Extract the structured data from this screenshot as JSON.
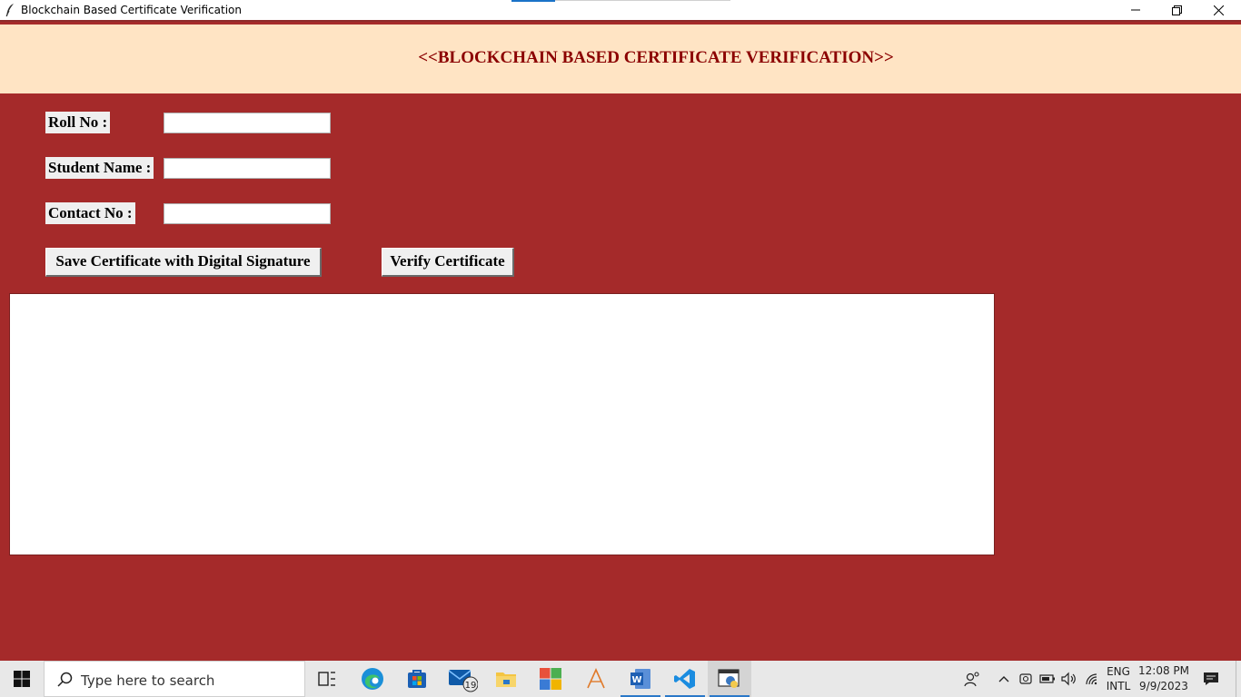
{
  "window": {
    "title": "Blockchain Based Certificate Verification"
  },
  "header": {
    "title": "<<BLOCKCHAIN BASED CERTIFICATE VERIFICATION>>",
    "background": "#ffe4c4",
    "title_color": "#8b0000"
  },
  "form": {
    "background": "#a52a2a",
    "fields": [
      {
        "label": "Roll No :",
        "value": ""
      },
      {
        "label": "Student Name :",
        "value": ""
      },
      {
        "label": "Contact No :",
        "value": ""
      }
    ],
    "buttons": {
      "save_label": "Save Certificate with Digital Signature",
      "verify_label": "Verify Certificate"
    },
    "output_text": ""
  },
  "taskbar": {
    "search_placeholder": "Type here to search",
    "mail_badge": "19",
    "language": "ENG",
    "layout": "INTL",
    "time": "12:08 PM",
    "date": "9/9/2023",
    "apps": [
      "task-view",
      "edge",
      "store",
      "mail",
      "file-explorer",
      "office",
      "adobe",
      "word",
      "vscode",
      "python"
    ]
  }
}
